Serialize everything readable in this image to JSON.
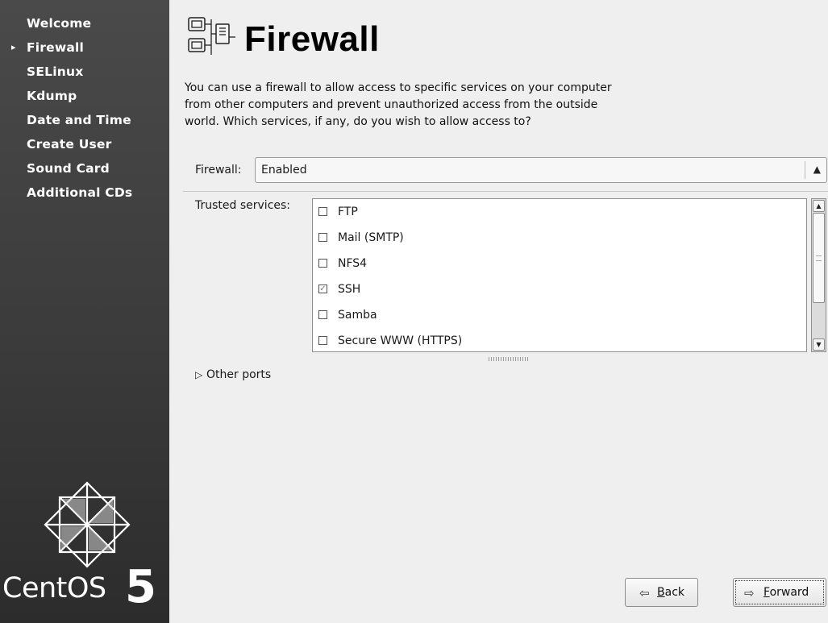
{
  "sidebar": {
    "steps": [
      {
        "label": "Welcome",
        "current": false
      },
      {
        "label": "Firewall",
        "current": true
      },
      {
        "label": "SELinux",
        "current": false
      },
      {
        "label": "Kdump",
        "current": false
      },
      {
        "label": "Date and Time",
        "current": false
      },
      {
        "label": "Create User",
        "current": false
      },
      {
        "label": "Sound Card",
        "current": false
      },
      {
        "label": "Additional CDs",
        "current": false
      }
    ],
    "logo": {
      "word": "CentOS",
      "version": "5"
    }
  },
  "page": {
    "title": "Firewall",
    "description_lines": [
      "You can use a firewall to allow access to specific services on your computer",
      "from other computers and prevent unauthorized access from the outside",
      "world.  Which services, if any, do you wish to allow access to?"
    ]
  },
  "firewall": {
    "label": "Firewall:",
    "selected": "Enabled"
  },
  "services": {
    "label": "Trusted services:",
    "items": [
      {
        "label": "FTP",
        "checked": false
      },
      {
        "label": "Mail (SMTP)",
        "checked": false
      },
      {
        "label": "NFS4",
        "checked": false
      },
      {
        "label": "SSH",
        "checked": true
      },
      {
        "label": "Samba",
        "checked": false
      },
      {
        "label": "Secure WWW (HTTPS)",
        "checked": false
      }
    ]
  },
  "other_ports": {
    "label": "Other ports",
    "expanded": false
  },
  "buttons": {
    "back": {
      "mnemonic": "B",
      "rest": "ack"
    },
    "forward": {
      "mnemonic": "F",
      "rest": "orward"
    }
  },
  "icons": {
    "step_arrow": "triangle-right-icon",
    "header": "network-firewall-icon",
    "back": "arrow-left-icon",
    "forward": "arrow-right-icon",
    "expander": "triangle-right-outline-icon"
  }
}
